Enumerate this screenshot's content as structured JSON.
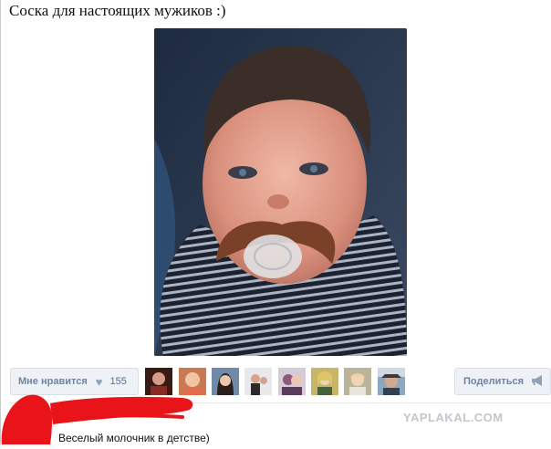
{
  "post": {
    "title": "Соска для настоящих мужиков :)"
  },
  "actions": {
    "like_label": "Мне нравится",
    "like_icon": "heart-icon",
    "like_count": "155",
    "share_label": "Поделиться",
    "share_icon": "megaphone-icon"
  },
  "comment": {
    "text": "Веселый молочник в детстве)"
  },
  "watermark": "YAPLAKAL.COM",
  "colors": {
    "button_bg": "#eef1f5",
    "button_text": "#6f84a0",
    "redaction": "#e8141a"
  }
}
